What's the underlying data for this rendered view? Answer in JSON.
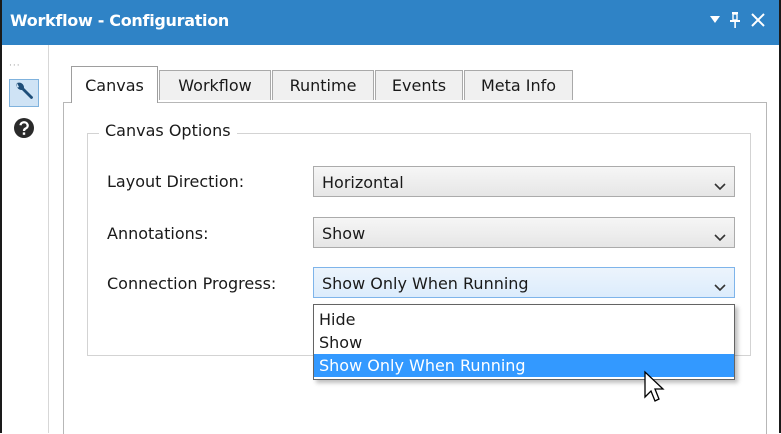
{
  "window": {
    "title": "Workflow - Configuration",
    "dropdown_glyph": "▾",
    "pin_icon": "pin-icon",
    "close_glyph": "✕"
  },
  "sidebar": {
    "grip": "···",
    "items": [
      {
        "icon": "wrench-icon",
        "selected": true
      },
      {
        "icon": "help-icon",
        "selected": false
      }
    ]
  },
  "tabs": [
    {
      "label": "Canvas",
      "active": true
    },
    {
      "label": "Workflow",
      "active": false
    },
    {
      "label": "Runtime",
      "active": false
    },
    {
      "label": "Events",
      "active": false
    },
    {
      "label": "Meta Info",
      "active": false
    }
  ],
  "canvas_options": {
    "group_title": "Canvas Options",
    "layout_direction": {
      "label": "Layout Direction:",
      "value": "Horizontal"
    },
    "annotations": {
      "label": "Annotations:",
      "value": "Show"
    },
    "connection_progress": {
      "label": "Connection Progress:",
      "value": "Show Only When Running",
      "options": [
        "Hide",
        "Show",
        "Show Only When Running"
      ],
      "highlighted": "Show Only When Running"
    }
  },
  "colors": {
    "titlebar": "#2f83c6",
    "highlight": "#3399ff",
    "focus_border": "#7eb4ea"
  }
}
